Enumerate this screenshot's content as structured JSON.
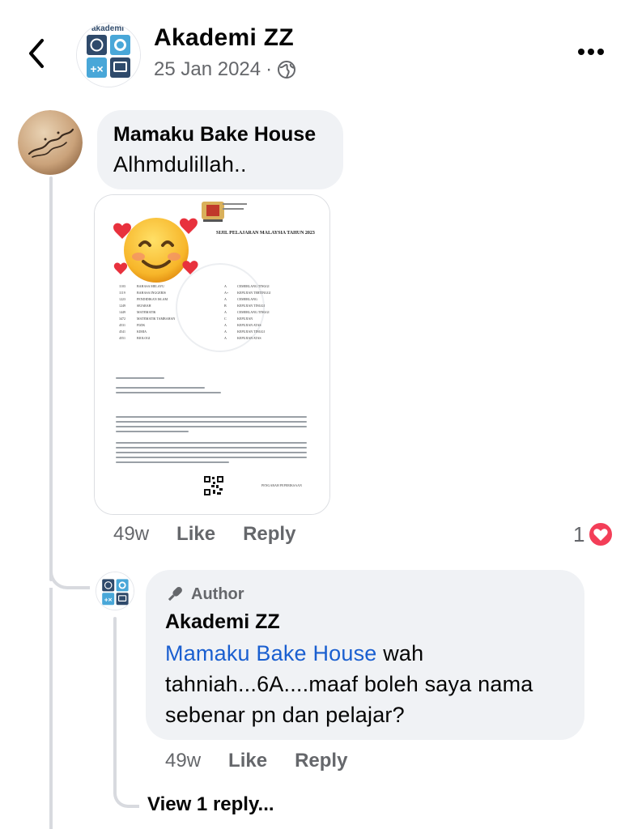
{
  "header": {
    "page_name": "Akademi ZZ",
    "date": "25 Jan 2024",
    "separator": "·",
    "avatar_text": "akademi"
  },
  "comment": {
    "author": "Mamaku Bake House",
    "text": "Alhmdulillah..",
    "time": "49w",
    "like_label": "Like",
    "reply_label": "Reply",
    "reaction_count": "1",
    "attachment": {
      "title": "SIJIL PELAJARAN MALAYSIA TAHUN 2023",
      "subjects": [
        {
          "code": "1103",
          "name": "BAHASA MELAYU",
          "grade": "A",
          "remark": "CEMERLANG TINGGI"
        },
        {
          "code": "1119",
          "name": "BAHASA INGGERIS",
          "grade": "A+",
          "remark": "KEPUJIAN TERTINGGI"
        },
        {
          "code": "1223",
          "name": "PENDIDIKAN ISLAM",
          "grade": "A",
          "remark": "CEMERLANG"
        },
        {
          "code": "1249",
          "name": "SEJARAH",
          "grade": "B",
          "remark": "KEPUJIAN TINGGI"
        },
        {
          "code": "1449",
          "name": "MATEMATIK",
          "grade": "A",
          "remark": "CEMERLANG TINGGI"
        },
        {
          "code": "3472",
          "name": "MATEMATIK TAMBAHAN",
          "grade": "C",
          "remark": "KEPUJIAN"
        },
        {
          "code": "4531",
          "name": "FIZIK",
          "grade": "A",
          "remark": "KEPUJIAN ATAS"
        },
        {
          "code": "4541",
          "name": "KIMIA",
          "grade": "A",
          "remark": "KEPUJIAN TINGGI"
        },
        {
          "code": "4551",
          "name": "BIOLOGI",
          "grade": "A",
          "remark": "KEPUJIAN ATAS"
        }
      ],
      "footer": "PENGARAH PEPERIKSAAN"
    }
  },
  "reply": {
    "badge": "Author",
    "author": "Akademi ZZ",
    "mention": "Mamaku Bake House",
    "text": " wah tahniah...6A....maaf boleh saya nama sebenar pn dan pelajar?",
    "time": "49w",
    "like_label": "Like",
    "reply_label": "Reply"
  },
  "view_replies": "View 1 reply...",
  "colors": {
    "bubble": "#f0f2f5",
    "secondary_text": "#65676b",
    "mention": "#1a5fd0",
    "heart": "#f33e58"
  },
  "icons": {
    "back": "chevron-left-icon",
    "more": "more-dots-icon",
    "audience": "globe-icon",
    "reaction": "love-reaction-icon",
    "badge": "microphone-icon"
  }
}
